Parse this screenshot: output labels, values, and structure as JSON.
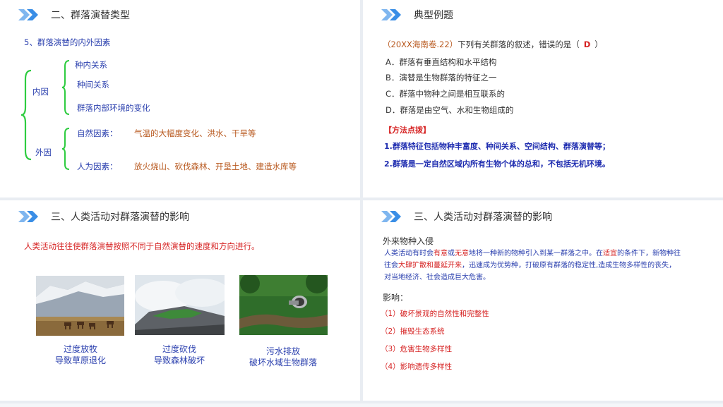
{
  "slide1": {
    "title": "二、群落演替类型",
    "subtitle": "5、群落演替的内外因素",
    "inner_label": "内因",
    "inner_items": [
      "种内关系",
      "种间关系",
      "群落内部环境的变化"
    ],
    "outer_label": "外因",
    "outer_items": [
      {
        "label": "自然因素：",
        "value": "气温的大幅度变化、洪水、干旱等"
      },
      {
        "label": "人为因素：",
        "value": "放火烧山、砍伐森林、开垦土地、建造水库等"
      }
    ],
    "brace_color": "#2ecc40"
  },
  "slide2": {
    "title": "典型例题",
    "question_src": "（20XX海南卷.22）",
    "question_text": "下列有关群落的叙述，错误的是（",
    "answer": "D",
    "question_end": "）",
    "options": [
      "A．群落有垂直结构和水平结构",
      "B．演替是生物群落的特征之一",
      "C．群落中物种之间是相互联系的",
      "D．群落是由空气、水和生物组成的"
    ],
    "method_title": "【方法点拨】",
    "tips": [
      "1.群落特征包括物种丰富度、种间关系、空间结构、群落演替等；",
      "2.群落是一定自然区域内所有生物个体的总和，不包括无机环境。"
    ]
  },
  "slide3": {
    "title": "三、人类活动对群落演替的影响",
    "intro": "人类活动往往使群落演替按照不同于自然演替的速度和方向进行。",
    "images": [
      {
        "icon": "grassland-horses-photo",
        "caption": [
          "过度放牧",
          "导致草原退化"
        ]
      },
      {
        "icon": "deforested-mountain-photo",
        "caption": [
          "过度砍伐",
          "导致森林破坏"
        ]
      },
      {
        "icon": "sewage-pipe-photo",
        "caption": [
          "污水排放",
          "破坏水域生物群落"
        ]
      }
    ]
  },
  "slide4": {
    "title": "三、人类活动对群落演替的影响",
    "heading": "外来物种入侵",
    "para_line1": [
      "人类活动有时会",
      "有意",
      "或",
      "无意",
      "地将一种新的物种引入到某一群落之中。在",
      "适宜",
      "的条件下，新物种往"
    ],
    "para_line2": [
      "往会",
      "大肆扩散和蔓延开来",
      "，迅速成为优势种，打破原有群落的稳定性,造成生物多样性的丧失，"
    ],
    "para_line3": "对当地经济、社会造成巨大危害。",
    "impact_label": "影响：",
    "impacts": [
      "（1）破坏景观的自然性和完整性",
      "（2）摧毁生态系统",
      "（3）危害生物多样性",
      "（4）影响遗传多样性"
    ]
  },
  "colors": {
    "chevron": "#3a8ee6",
    "accent_red": "#d62222",
    "text_blue": "#2a3fae",
    "text_orange": "#b8581e"
  }
}
